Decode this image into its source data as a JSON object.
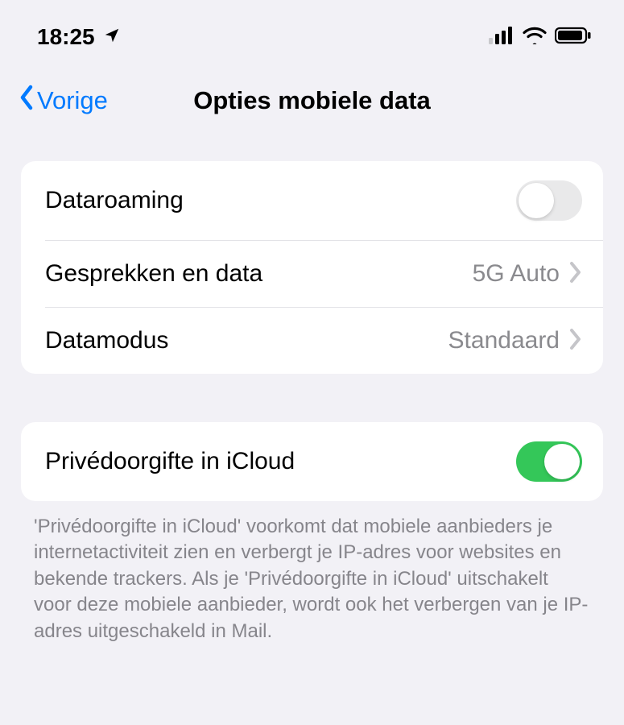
{
  "status": {
    "time": "18:25"
  },
  "nav": {
    "back_label": "Vorige",
    "title": "Opties mobiele data"
  },
  "group1": {
    "row0": {
      "label": "Dataroaming",
      "toggle_on": false
    },
    "row1": {
      "label": "Gesprekken en data",
      "value": "5G Auto"
    },
    "row2": {
      "label": "Datamodus",
      "value": "Standaard"
    }
  },
  "group2": {
    "row0": {
      "label": "Privédoorgifte in iCloud",
      "toggle_on": true
    }
  },
  "footer": "'Privédoorgifte in iCloud' voorkomt dat mobiele aanbieders je internetactiviteit zien en verbergt je IP-adres voor websites en bekende trackers. Als je 'Privédoorgifte in iCloud' uitschakelt voor deze mobiele aanbieder, wordt ook het verbergen van je IP-adres uitgeschakeld in Mail."
}
